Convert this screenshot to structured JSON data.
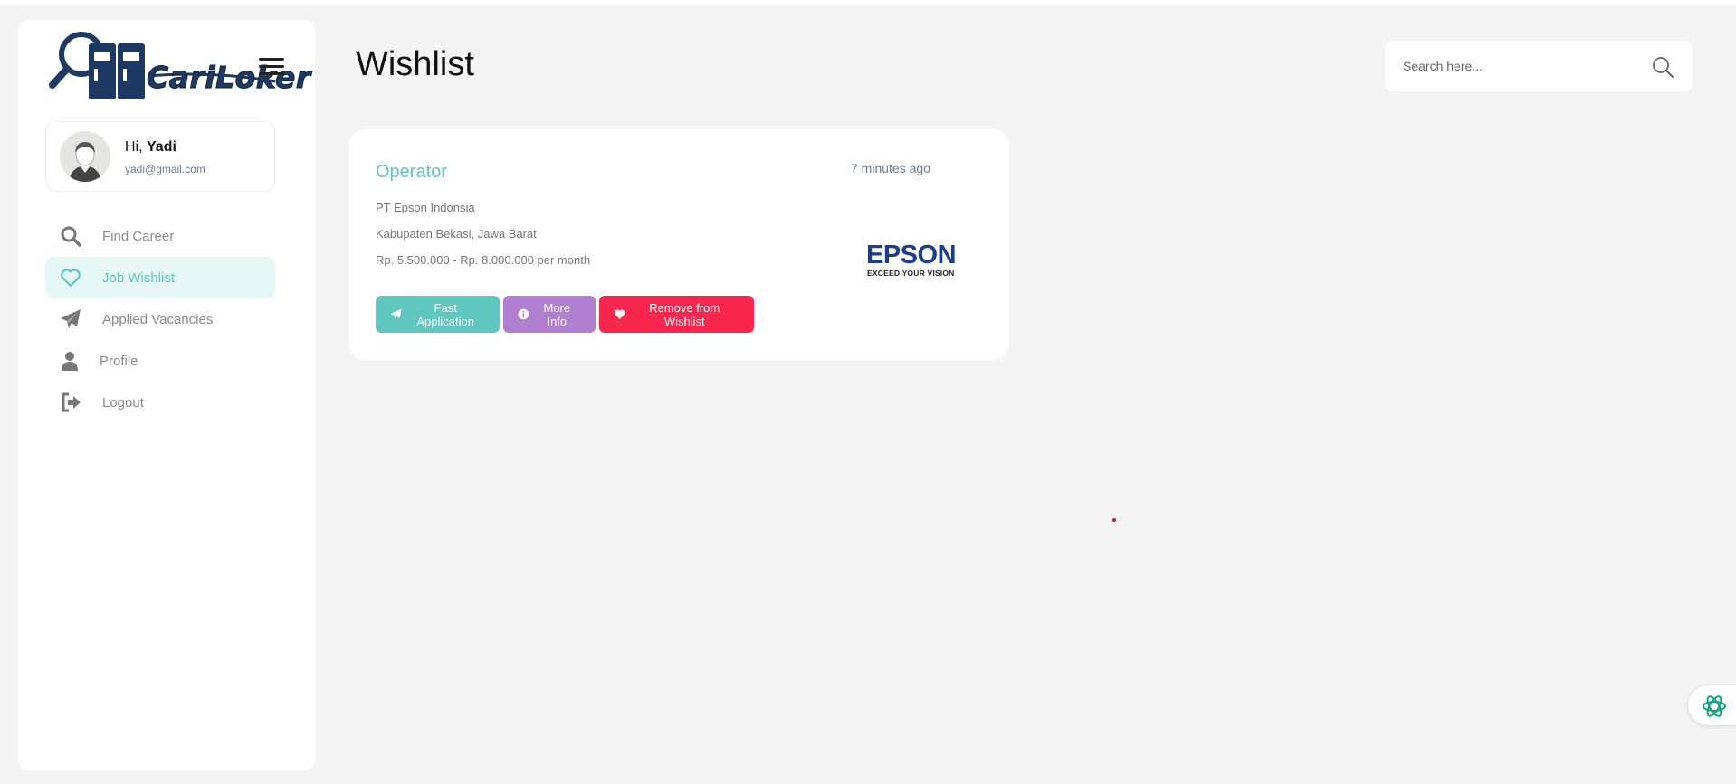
{
  "brand": {
    "logo_text": "CariLoker"
  },
  "user": {
    "greeting": "Hi,",
    "name": "Yadi",
    "email": "yadi@gmail.com"
  },
  "nav": {
    "items": [
      {
        "label": "Find Career",
        "icon": "search-icon",
        "active": false
      },
      {
        "label": "Job Wishlist",
        "icon": "heart-icon",
        "active": true
      },
      {
        "label": "Applied Vacancies",
        "icon": "paper-plane-icon",
        "active": false
      },
      {
        "label": "Profile",
        "icon": "user-icon",
        "active": false
      },
      {
        "label": "Logout",
        "icon": "logout-icon",
        "active": false
      }
    ]
  },
  "page": {
    "title": "Wishlist"
  },
  "search": {
    "placeholder": "Search here..."
  },
  "job": {
    "title": "Operator",
    "posted": "7 minutes ago",
    "company": "PT Epson Indonsia",
    "location": "Kabupaten Bekasi, Jawa Barat",
    "salary": "Rp. 5.500.000 - Rp. 8.000.000 per month",
    "logo_name": "EPSON",
    "logo_tagline": "EXCEED YOUR VISION",
    "buttons": {
      "fast_apply": "Fast Application",
      "more_info": "More Info",
      "remove": "Remove from Wishlist"
    }
  },
  "colors": {
    "accent": "#5fc6c0",
    "info": "#b07fd0",
    "danger": "#f7274f",
    "active_nav_bg": "#e6f7f6",
    "background": "#f4f4f4"
  }
}
